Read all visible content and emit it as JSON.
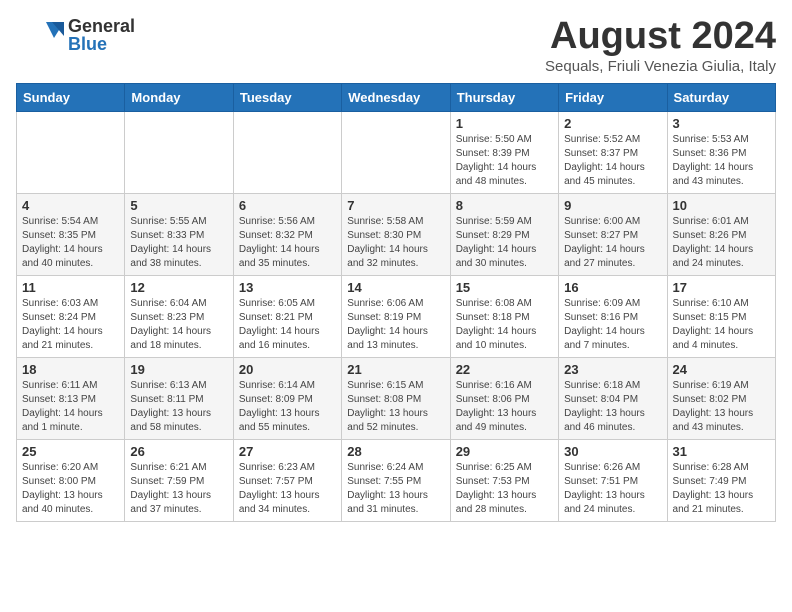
{
  "header": {
    "logo_general": "General",
    "logo_blue": "Blue",
    "month_title": "August 2024",
    "subtitle": "Sequals, Friuli Venezia Giulia, Italy"
  },
  "days_of_week": [
    "Sunday",
    "Monday",
    "Tuesday",
    "Wednesday",
    "Thursday",
    "Friday",
    "Saturday"
  ],
  "weeks": [
    [
      {
        "day": "",
        "info": ""
      },
      {
        "day": "",
        "info": ""
      },
      {
        "day": "",
        "info": ""
      },
      {
        "day": "",
        "info": ""
      },
      {
        "day": "1",
        "info": "Sunrise: 5:50 AM\nSunset: 8:39 PM\nDaylight: 14 hours\nand 48 minutes."
      },
      {
        "day": "2",
        "info": "Sunrise: 5:52 AM\nSunset: 8:37 PM\nDaylight: 14 hours\nand 45 minutes."
      },
      {
        "day": "3",
        "info": "Sunrise: 5:53 AM\nSunset: 8:36 PM\nDaylight: 14 hours\nand 43 minutes."
      }
    ],
    [
      {
        "day": "4",
        "info": "Sunrise: 5:54 AM\nSunset: 8:35 PM\nDaylight: 14 hours\nand 40 minutes."
      },
      {
        "day": "5",
        "info": "Sunrise: 5:55 AM\nSunset: 8:33 PM\nDaylight: 14 hours\nand 38 minutes."
      },
      {
        "day": "6",
        "info": "Sunrise: 5:56 AM\nSunset: 8:32 PM\nDaylight: 14 hours\nand 35 minutes."
      },
      {
        "day": "7",
        "info": "Sunrise: 5:58 AM\nSunset: 8:30 PM\nDaylight: 14 hours\nand 32 minutes."
      },
      {
        "day": "8",
        "info": "Sunrise: 5:59 AM\nSunset: 8:29 PM\nDaylight: 14 hours\nand 30 minutes."
      },
      {
        "day": "9",
        "info": "Sunrise: 6:00 AM\nSunset: 8:27 PM\nDaylight: 14 hours\nand 27 minutes."
      },
      {
        "day": "10",
        "info": "Sunrise: 6:01 AM\nSunset: 8:26 PM\nDaylight: 14 hours\nand 24 minutes."
      }
    ],
    [
      {
        "day": "11",
        "info": "Sunrise: 6:03 AM\nSunset: 8:24 PM\nDaylight: 14 hours\nand 21 minutes."
      },
      {
        "day": "12",
        "info": "Sunrise: 6:04 AM\nSunset: 8:23 PM\nDaylight: 14 hours\nand 18 minutes."
      },
      {
        "day": "13",
        "info": "Sunrise: 6:05 AM\nSunset: 8:21 PM\nDaylight: 14 hours\nand 16 minutes."
      },
      {
        "day": "14",
        "info": "Sunrise: 6:06 AM\nSunset: 8:19 PM\nDaylight: 14 hours\nand 13 minutes."
      },
      {
        "day": "15",
        "info": "Sunrise: 6:08 AM\nSunset: 8:18 PM\nDaylight: 14 hours\nand 10 minutes."
      },
      {
        "day": "16",
        "info": "Sunrise: 6:09 AM\nSunset: 8:16 PM\nDaylight: 14 hours\nand 7 minutes."
      },
      {
        "day": "17",
        "info": "Sunrise: 6:10 AM\nSunset: 8:15 PM\nDaylight: 14 hours\nand 4 minutes."
      }
    ],
    [
      {
        "day": "18",
        "info": "Sunrise: 6:11 AM\nSunset: 8:13 PM\nDaylight: 14 hours\nand 1 minute."
      },
      {
        "day": "19",
        "info": "Sunrise: 6:13 AM\nSunset: 8:11 PM\nDaylight: 13 hours\nand 58 minutes."
      },
      {
        "day": "20",
        "info": "Sunrise: 6:14 AM\nSunset: 8:09 PM\nDaylight: 13 hours\nand 55 minutes."
      },
      {
        "day": "21",
        "info": "Sunrise: 6:15 AM\nSunset: 8:08 PM\nDaylight: 13 hours\nand 52 minutes."
      },
      {
        "day": "22",
        "info": "Sunrise: 6:16 AM\nSunset: 8:06 PM\nDaylight: 13 hours\nand 49 minutes."
      },
      {
        "day": "23",
        "info": "Sunrise: 6:18 AM\nSunset: 8:04 PM\nDaylight: 13 hours\nand 46 minutes."
      },
      {
        "day": "24",
        "info": "Sunrise: 6:19 AM\nSunset: 8:02 PM\nDaylight: 13 hours\nand 43 minutes."
      }
    ],
    [
      {
        "day": "25",
        "info": "Sunrise: 6:20 AM\nSunset: 8:00 PM\nDaylight: 13 hours\nand 40 minutes."
      },
      {
        "day": "26",
        "info": "Sunrise: 6:21 AM\nSunset: 7:59 PM\nDaylight: 13 hours\nand 37 minutes."
      },
      {
        "day": "27",
        "info": "Sunrise: 6:23 AM\nSunset: 7:57 PM\nDaylight: 13 hours\nand 34 minutes."
      },
      {
        "day": "28",
        "info": "Sunrise: 6:24 AM\nSunset: 7:55 PM\nDaylight: 13 hours\nand 31 minutes."
      },
      {
        "day": "29",
        "info": "Sunrise: 6:25 AM\nSunset: 7:53 PM\nDaylight: 13 hours\nand 28 minutes."
      },
      {
        "day": "30",
        "info": "Sunrise: 6:26 AM\nSunset: 7:51 PM\nDaylight: 13 hours\nand 24 minutes."
      },
      {
        "day": "31",
        "info": "Sunrise: 6:28 AM\nSunset: 7:49 PM\nDaylight: 13 hours\nand 21 minutes."
      }
    ]
  ]
}
